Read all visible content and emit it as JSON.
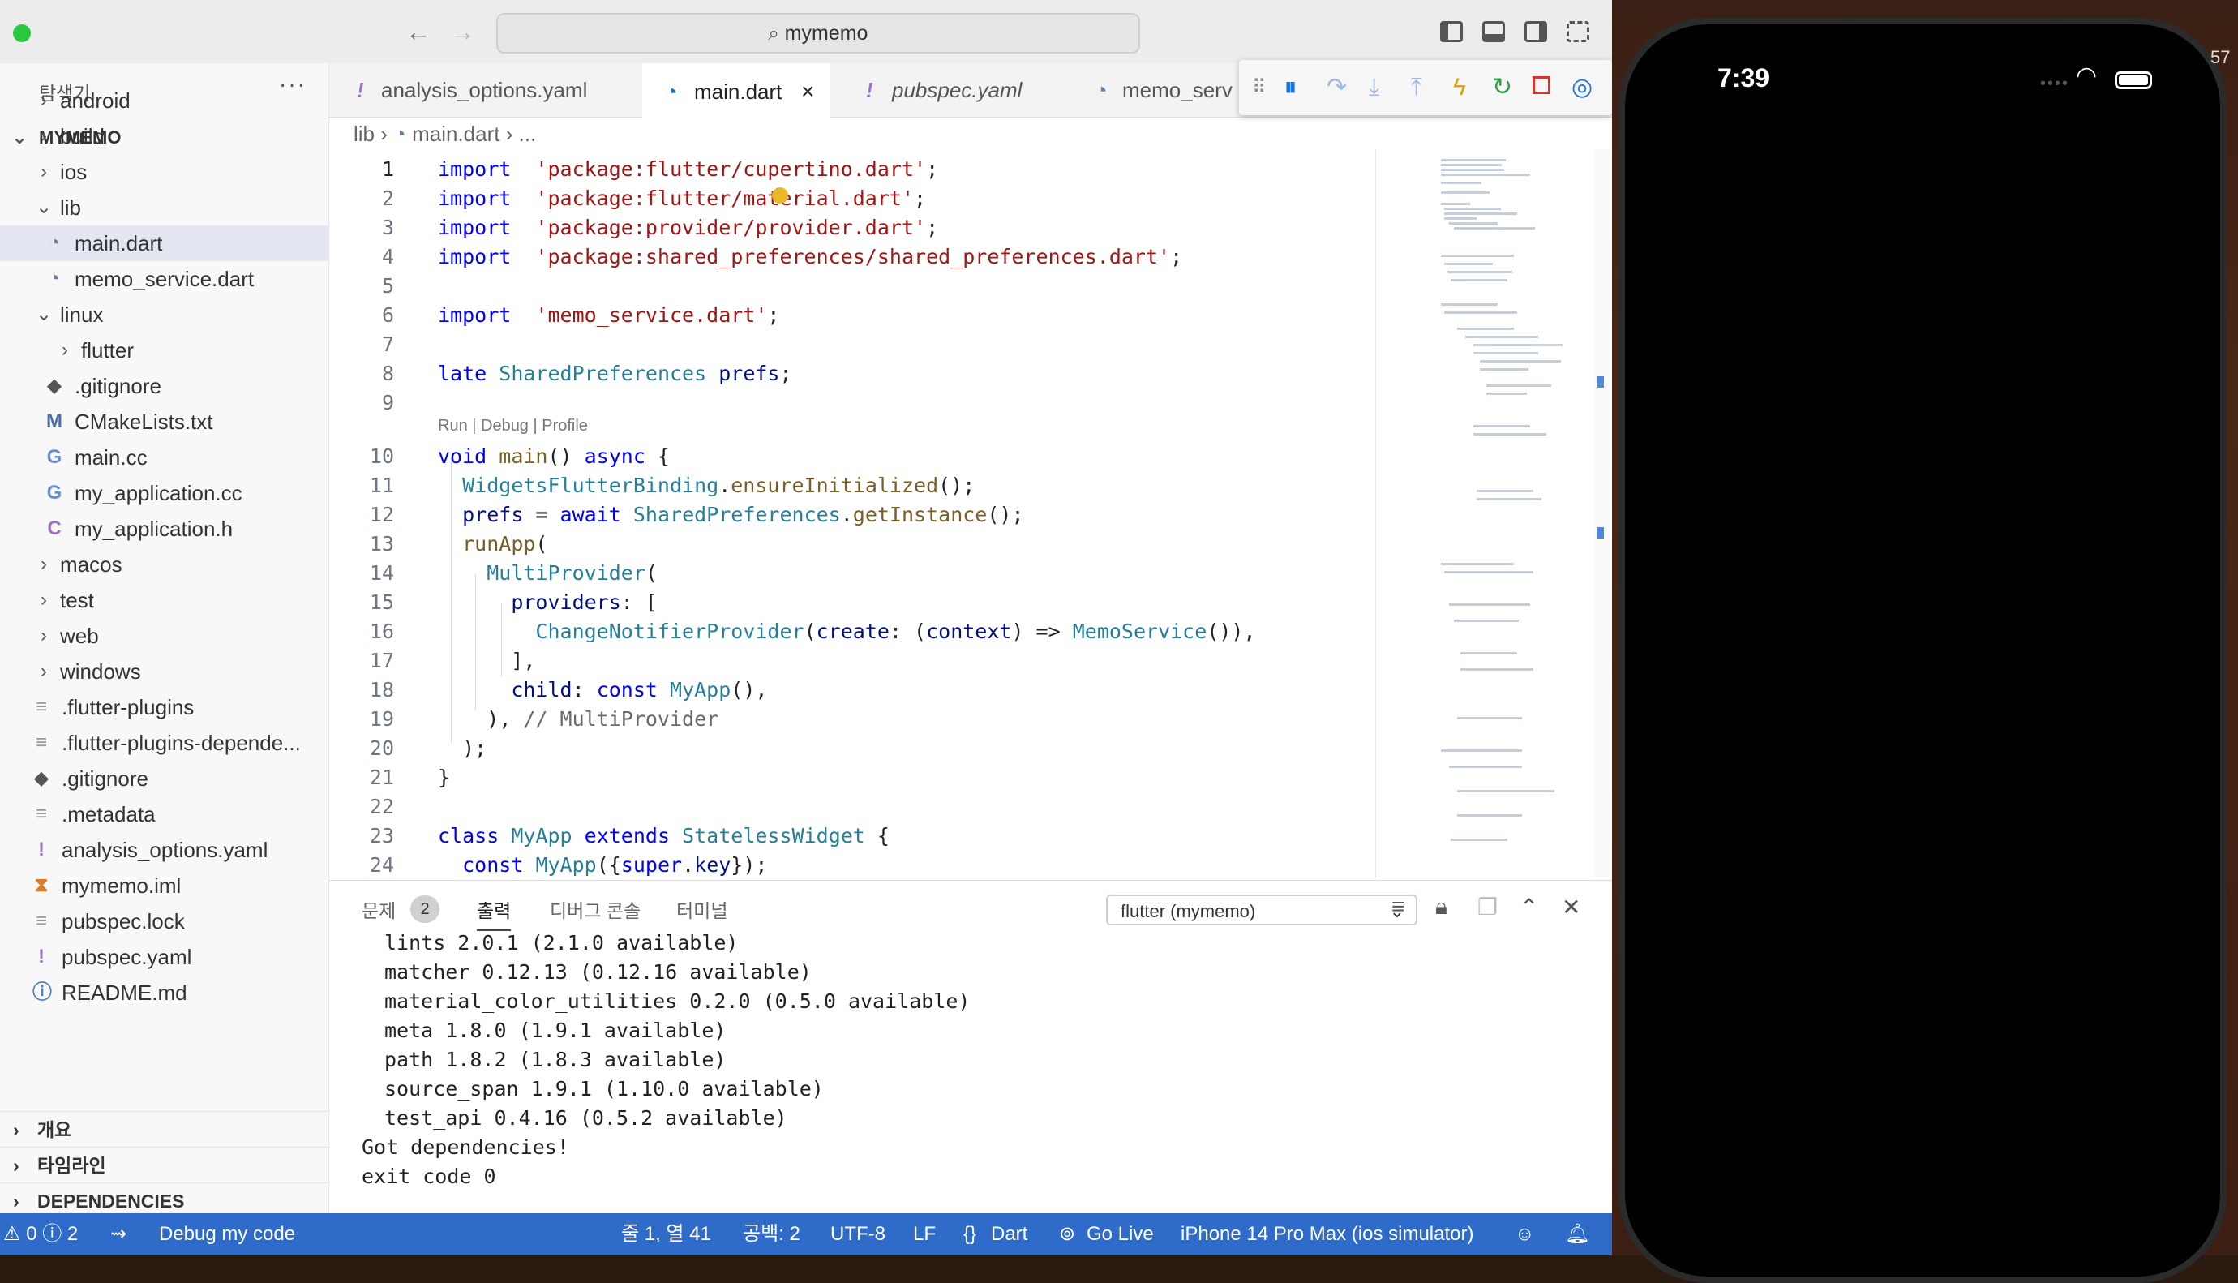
{
  "window": {
    "search_title": "mymemo"
  },
  "sidebar": {
    "title": "탐색기",
    "more": "···",
    "root_label": "MYMEMO",
    "tree": [
      {
        "label": "android",
        "type": "folder",
        "depth": 1
      },
      {
        "label": "build",
        "type": "folder",
        "depth": 1
      },
      {
        "label": "ios",
        "type": "folder",
        "depth": 1
      },
      {
        "label": "lib",
        "type": "folder-open",
        "depth": 1
      },
      {
        "label": "main.dart",
        "type": "dart",
        "depth": 2,
        "selected": true
      },
      {
        "label": "memo_service.dart",
        "type": "dart",
        "depth": 2
      },
      {
        "label": "linux",
        "type": "folder-open",
        "depth": 1
      },
      {
        "label": "flutter",
        "type": "folder",
        "depth": 2
      },
      {
        "label": ".gitignore",
        "type": "git",
        "depth": 2
      },
      {
        "label": "CMakeLists.txt",
        "type": "cmake",
        "depth": 2
      },
      {
        "label": "main.cc",
        "type": "cpp",
        "depth": 2
      },
      {
        "label": "my_application.cc",
        "type": "cpp",
        "depth": 2
      },
      {
        "label": "my_application.h",
        "type": "h",
        "depth": 2
      },
      {
        "label": "macos",
        "type": "folder",
        "depth": 1
      },
      {
        "label": "test",
        "type": "folder",
        "depth": 1
      },
      {
        "label": "web",
        "type": "folder",
        "depth": 1
      },
      {
        "label": "windows",
        "type": "folder",
        "depth": 1
      },
      {
        "label": ".flutter-plugins",
        "type": "file",
        "depth": 1
      },
      {
        "label": ".flutter-plugins-depende...",
        "type": "file",
        "depth": 1
      },
      {
        "label": ".gitignore",
        "type": "git",
        "depth": 1
      },
      {
        "label": ".metadata",
        "type": "file",
        "depth": 1
      },
      {
        "label": "analysis_options.yaml",
        "type": "yaml",
        "depth": 1
      },
      {
        "label": "mymemo.iml",
        "type": "rss",
        "depth": 1
      },
      {
        "label": "pubspec.lock",
        "type": "file",
        "depth": 1
      },
      {
        "label": "pubspec.yaml",
        "type": "yaml",
        "depth": 1
      },
      {
        "label": "README.md",
        "type": "info",
        "depth": 1
      }
    ],
    "sections": [
      "개요",
      "타임라인",
      "DEPENDENCIES"
    ]
  },
  "tabs": [
    {
      "label": "analysis_options.yaml",
      "icon": "!",
      "italic": false,
      "active": false
    },
    {
      "label": "main.dart",
      "icon": "dart",
      "italic": false,
      "active": true
    },
    {
      "label": "pubspec.yaml",
      "icon": "!",
      "italic": true,
      "active": false
    },
    {
      "label": "memo_serv",
      "icon": "dart",
      "italic": false,
      "active": false
    }
  ],
  "breadcrumb": {
    "folder": "lib",
    "file": "main.dart",
    "rest": "..."
  },
  "codelens": "Run | Debug | Profile",
  "code_lines": [
    {
      "n": "1",
      "tokens": [
        [
          "kw",
          "import"
        ],
        [
          "",
          "  "
        ],
        [
          "str",
          "'package:flutter/cupertino.dart'"
        ],
        [
          "",
          ";"
        ]
      ]
    },
    {
      "n": "2",
      "tokens": [
        [
          "kw",
          "import"
        ],
        [
          "",
          "  "
        ],
        [
          "str",
          "'package:flutter/material.dart'"
        ],
        [
          "",
          ";"
        ]
      ]
    },
    {
      "n": "3",
      "tokens": [
        [
          "kw",
          "import"
        ],
        [
          "",
          "  "
        ],
        [
          "str",
          "'package:provider/provider.dart'"
        ],
        [
          "",
          ";"
        ]
      ]
    },
    {
      "n": "4",
      "tokens": [
        [
          "kw",
          "import"
        ],
        [
          "",
          "  "
        ],
        [
          "str",
          "'package:shared_preferences/shared_preferences.dart'"
        ],
        [
          "",
          ";"
        ]
      ]
    },
    {
      "n": "5",
      "tokens": []
    },
    {
      "n": "6",
      "tokens": [
        [
          "kw",
          "import"
        ],
        [
          "",
          "  "
        ],
        [
          "str",
          "'memo_service.dart'"
        ],
        [
          "",
          ";"
        ]
      ]
    },
    {
      "n": "7",
      "tokens": []
    },
    {
      "n": "8",
      "tokens": [
        [
          "kw",
          "late"
        ],
        [
          "",
          " "
        ],
        [
          "ty",
          "SharedPreferences"
        ],
        [
          "",
          " "
        ],
        [
          "var",
          "prefs"
        ],
        [
          "",
          ";"
        ]
      ]
    },
    {
      "n": "9",
      "tokens": []
    },
    {
      "n": "10",
      "tokens": [
        [
          "kw",
          "void"
        ],
        [
          "",
          " "
        ],
        [
          "fn",
          "main"
        ],
        [
          "",
          "() "
        ],
        [
          "kw",
          "async"
        ],
        [
          "",
          " {"
        ]
      ]
    },
    {
      "n": "11",
      "tokens": [
        [
          "",
          "  "
        ],
        [
          "ty",
          "WidgetsFlutterBinding"
        ],
        [
          "",
          "."
        ],
        [
          "fn",
          "ensureInitialized"
        ],
        [
          "",
          "();"
        ]
      ]
    },
    {
      "n": "12",
      "tokens": [
        [
          "",
          "  "
        ],
        [
          "var",
          "prefs"
        ],
        [
          "",
          " = "
        ],
        [
          "kw",
          "await"
        ],
        [
          "",
          " "
        ],
        [
          "ty",
          "SharedPreferences"
        ],
        [
          "",
          "."
        ],
        [
          "fn",
          "getInstance"
        ],
        [
          "",
          "();"
        ]
      ]
    },
    {
      "n": "13",
      "tokens": [
        [
          "",
          "  "
        ],
        [
          "fn",
          "runApp"
        ],
        [
          "",
          "("
        ]
      ]
    },
    {
      "n": "14",
      "tokens": [
        [
          "",
          "    "
        ],
        [
          "ty",
          "MultiProvider"
        ],
        [
          "",
          "("
        ]
      ]
    },
    {
      "n": "15",
      "tokens": [
        [
          "",
          "      "
        ],
        [
          "var",
          "providers"
        ],
        [
          "",
          ": ["
        ]
      ]
    },
    {
      "n": "16",
      "tokens": [
        [
          "",
          "        "
        ],
        [
          "ty",
          "ChangeNotifierProvider"
        ],
        [
          "",
          "("
        ],
        [
          "var",
          "create"
        ],
        [
          "",
          ": ("
        ],
        [
          "var",
          "context"
        ],
        [
          "",
          ") => "
        ],
        [
          "ty",
          "MemoService"
        ],
        [
          "",
          "()),"
        ]
      ]
    },
    {
      "n": "17",
      "tokens": [
        [
          "",
          "      ],"
        ]
      ]
    },
    {
      "n": "18",
      "tokens": [
        [
          "",
          "      "
        ],
        [
          "var",
          "child"
        ],
        [
          "",
          ": "
        ],
        [
          "kw",
          "const"
        ],
        [
          "",
          " "
        ],
        [
          "ty",
          "MyApp"
        ],
        [
          "",
          "(),"
        ]
      ]
    },
    {
      "n": "19",
      "tokens": [
        [
          "",
          "    ), "
        ],
        [
          "cm",
          "// MultiProvider"
        ]
      ]
    },
    {
      "n": "20",
      "tokens": [
        [
          "",
          "  );"
        ]
      ]
    },
    {
      "n": "21",
      "tokens": [
        [
          "",
          "}"
        ]
      ]
    },
    {
      "n": "22",
      "tokens": []
    },
    {
      "n": "23",
      "tokens": [
        [
          "kw",
          "class"
        ],
        [
          "",
          " "
        ],
        [
          "ty",
          "MyApp"
        ],
        [
          "",
          " "
        ],
        [
          "kw",
          "extends"
        ],
        [
          "",
          " "
        ],
        [
          "ty",
          "StatelessWidget"
        ],
        [
          "",
          " {"
        ]
      ]
    },
    {
      "n": "24",
      "tokens": [
        [
          "",
          "  "
        ],
        [
          "kw",
          "const"
        ],
        [
          "",
          " "
        ],
        [
          "ty",
          "MyApp"
        ],
        [
          "",
          "({"
        ],
        [
          "kw",
          "super"
        ],
        [
          "",
          "."
        ],
        [
          "var",
          "key"
        ],
        [
          "",
          "});"
        ]
      ]
    }
  ],
  "panel": {
    "tabs": [
      "문제",
      "출력",
      "디버그 콘솔",
      "터미널"
    ],
    "problem_count": "2",
    "output_channel": "flutter (mymemo)",
    "output_lines": [
      "lints 2.0.1 (2.1.0 available)",
      "matcher 0.12.13 (0.12.16 available)",
      "material_color_utilities 0.2.0 (0.5.0 available)",
      "meta 1.8.0 (1.9.1 available)",
      "path 1.8.2 (1.8.3 available)",
      "source_span 1.9.1 (1.10.0 available)",
      "test_api 0.4.16 (0.5.2 available)",
      "Got dependencies!",
      "exit code 0"
    ]
  },
  "statusbar": {
    "warnings": "0",
    "infos": "2",
    "debug_label": "Debug my code",
    "cursor": "줄 1, 열 41",
    "spaces": "공백: 2",
    "encoding": "UTF-8",
    "eol": "LF",
    "language": "Dart",
    "golive": "Go Live",
    "device": "iPhone 14 Pro Max (ios simulator)"
  },
  "phone": {
    "time": "7:39",
    "edge_clock": "57"
  },
  "colors": {
    "statusbar": "#2f6cc9",
    "keyword": "#0000ff",
    "string": "#a31515",
    "type": "#267f99"
  }
}
